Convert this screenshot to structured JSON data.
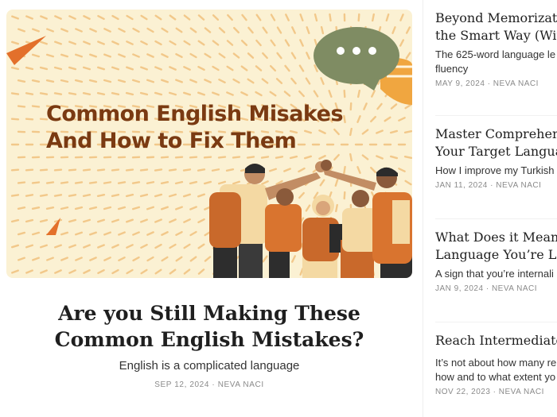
{
  "hero_image": {
    "headline_line1": "Common English Misakes",
    "headline_line2": "And How to Fix Them",
    "colors": {
      "background": "#fbf1d3",
      "dash": "#f2c88a",
      "accent": "#e3702b",
      "bubble": "#7f8c63",
      "text": "#7a3a12"
    }
  },
  "featured": {
    "title_line1": "Are you Still Making These",
    "title_line2": "Common English Mistakes?",
    "subtitle": "English is a complicated language",
    "date": "SEP 12, 2024",
    "author": "NEVA NACI",
    "separator": "·"
  },
  "sidebar_posts": [
    {
      "title_line1": "Beyond Memorizatio",
      "title_line2": "the Smart Way (With",
      "subtitle": "The 625-word language le fluency",
      "date": "MAY 9, 2024",
      "author": "NEVA NACI"
    },
    {
      "title_line1": "Master Comprehens",
      "title_line2": "Your Target Languag",
      "subtitle": "How I improve my Turkish",
      "date": "JAN 11, 2024",
      "author": "NEVA NACI"
    },
    {
      "title_line1": "What Does it Mean W",
      "title_line2": "Language You’re Lea",
      "subtitle": "A sign that you’re internali",
      "date": "JAN 9, 2024",
      "author": "NEVA NACI"
    },
    {
      "title_line1": "Reach Intermediate",
      "title_line2": "",
      "subtitle": "It’s not about how many re how and to what extent yo",
      "date": "NOV 22, 2023",
      "author": "NEVA NACI"
    }
  ]
}
